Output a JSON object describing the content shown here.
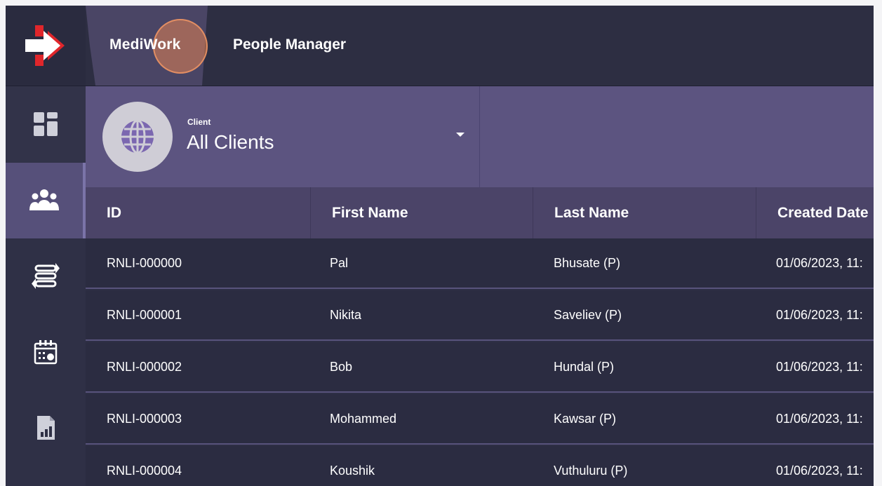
{
  "brand": {
    "name": "MediWork"
  },
  "header": {
    "title": "People Manager"
  },
  "filter": {
    "label": "Client",
    "value": "All Clients"
  },
  "table": {
    "columns": [
      "ID",
      "First Name",
      "Last Name",
      "Created Date"
    ],
    "rows": [
      {
        "id": "RNLI-000000",
        "first": "Pal",
        "last": "Bhusate (P)",
        "created": "01/06/2023, 11:"
      },
      {
        "id": "RNLI-000001",
        "first": "Nikita",
        "last": "Saveliev (P)",
        "created": "01/06/2023, 11:"
      },
      {
        "id": "RNLI-000002",
        "first": "Bob",
        "last": "Hundal (P)",
        "created": "01/06/2023, 11:"
      },
      {
        "id": "RNLI-000003",
        "first": "Mohammed",
        "last": "Kawsar (P)",
        "created": "01/06/2023, 11:"
      },
      {
        "id": "RNLI-000004",
        "first": "Koushik",
        "last": "Vuthuluru (P)",
        "created": "01/06/2023, 11:"
      }
    ]
  },
  "sidebar": {
    "items": [
      {
        "icon": "dashboard-icon"
      },
      {
        "icon": "people-icon",
        "active": true
      },
      {
        "icon": "transfer-icon"
      },
      {
        "icon": "calendar-icon"
      },
      {
        "icon": "report-icon"
      }
    ]
  },
  "colors": {
    "accent": "#5c5480",
    "header_bg": "#2d2e42",
    "row_bg": "#2b2c41",
    "logo_red": "#e0262b"
  }
}
